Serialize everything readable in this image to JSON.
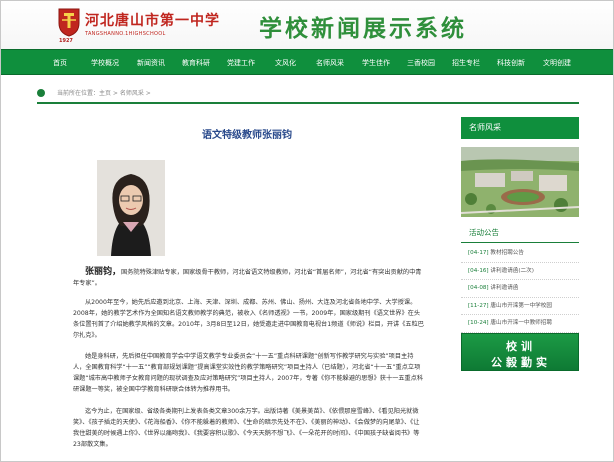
{
  "header": {
    "logo_year": "1927",
    "school_name": "河北唐山市第一中学",
    "school_name_en": "TANGSHANNO.1HIGHSCHOOL",
    "site_title": "学校新闻展示系统"
  },
  "nav": [
    "首页",
    "学校概况",
    "新闻资讯",
    "教育科研",
    "党建工作",
    "文风化",
    "名师风采",
    "学生佳作",
    "三香校园",
    "招生专栏",
    "科技创新",
    "文明创建"
  ],
  "breadcrumb": "当前所在位置：主页 > 名师风采 >",
  "article": {
    "title": "语文特级教师张丽钧",
    "name": "张丽钧，",
    "p1_rest": "国务院特殊津贴专家，国家级骨干教师，河北省语文特级教师，河北省“首届名师”，河北省“有突出贡献的中青年专家”。",
    "p2": "从2000年至今，她先后应邀到北京、上海、天津、深圳、成都、苏州、佛山、扬州、大连及河北省各地中学、大学授课。2008年，她的教学艺术作为全国知名语文教师教学的典范，被收入《名师透视》一书，2009年，国家级期刊《语文世界》在头条位置刊首了介绍她教学风格的文章。2010年，3月8日至12日，她受邀走进中国教育电视台1频道《师说》栏目，开讲《五粒巴尔扎克》。",
    "p3": "她是身科研，先后担任中国教育学会中学语文教学专业委员会“十一五”重点科研课题“创新写作教学研究与实验”项目主持人，全国教育科学“十一五”“教育部规划课题”提高课堂实效性的教学策略研究”项目主持人（已结题），河北省“十一五”重点立项课题“城市高中教师子女教育问题的现状调查及应对策略研究”项目主持人，2007年，专著《你不能躲避的思想》获十一五重点科研课题一等奖，被全国中学教育科研联合体转为推荐用书。",
    "p4": "迄今为止，在国家级、省级各类期刊上发表各类文章300余万字。出版诗著《美景美苗》、《依偎那座雪峰》、《看见阳光就微笑》、《孩子插走的天使》、《花海船香》、《你不能躲着的教师》、《生命的暗示先处不在》、《美丽的神动》、《会做梦的向尾草》、《让我住甜美的时候遇上你》、《世界以痛吻我》、《我要容积以歌》、《今天天鹅不想飞》、《一朵花开的时间》、《中国孩子缺省阅书》等23部散文集。"
  },
  "sidebar": {
    "famous_title": "名师风采",
    "notice_title": "活动公告",
    "notices": [
      {
        "date": "[04-17]",
        "text": "教材招聘公告"
      },
      {
        "date": "[04-16]",
        "text": "讲利邀请函(二次)"
      },
      {
        "date": "[04-08]",
        "text": "讲利邀请函"
      },
      {
        "date": "[11-27]",
        "text": "唐山市开滦第一中学校园"
      },
      {
        "date": "[10-24]",
        "text": "唐山市开滦一中教师招聘"
      }
    ],
    "banner_line1": "校训",
    "banner_line2": "公毅勤实"
  },
  "colors": {
    "brand_green": "#0f8f3d",
    "brand_red": "#c0261f",
    "title_blue": "#2a4a8c"
  }
}
